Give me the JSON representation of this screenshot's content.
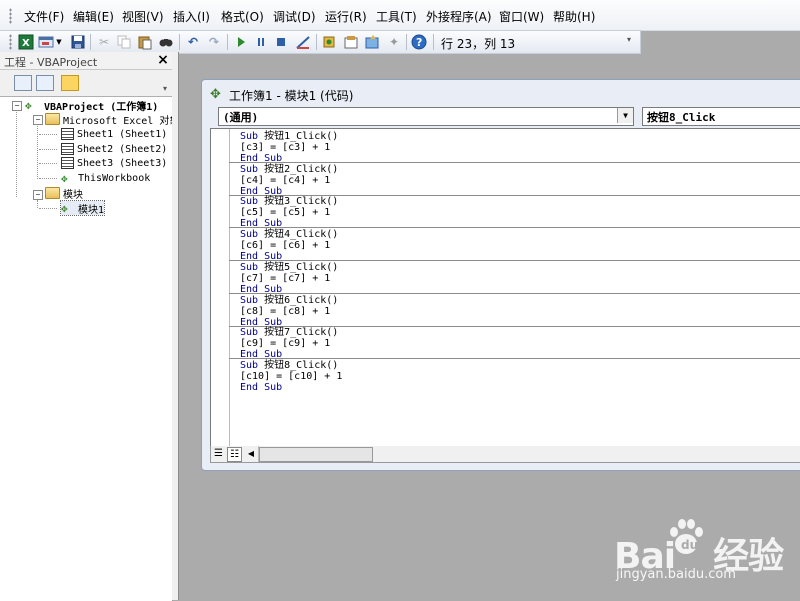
{
  "menubar": {
    "items": [
      "文件(F)",
      "编辑(E)",
      "视图(V)",
      "插入(I)",
      "格式(O)",
      "调试(D)",
      "运行(R)",
      "工具(T)",
      "外接程序(A)",
      "窗口(W)",
      "帮助(H)"
    ]
  },
  "toolbar": {
    "status": "行 23，列 13",
    "icons": [
      "excel-icon",
      "insert-userform-icon",
      "save-icon",
      "cut-icon",
      "copy-icon",
      "paste-icon",
      "find-icon",
      "undo-icon",
      "redo-icon",
      "run-icon",
      "break-icon",
      "reset-icon",
      "design-mode-icon",
      "project-explorer-icon",
      "properties-icon",
      "object-browser-icon",
      "toolbox-icon",
      "help-icon"
    ]
  },
  "project": {
    "title": "工程 - VBAProject",
    "tree": {
      "root": "VBAProject (工作簿1)",
      "excel_objects": "Microsoft Excel 对象",
      "sheets": [
        "Sheet1 (Sheet1)",
        "Sheet2 (Sheet2)",
        "Sheet3 (Sheet3)"
      ],
      "workbook": "ThisWorkbook",
      "modules_folder": "模块",
      "module": "模块1"
    }
  },
  "code_window": {
    "title": "工作簿1 - 模块1 (代码)",
    "object_combo": "(通用)",
    "proc_combo": "按钮8_Click",
    "procedures": [
      {
        "sub": "按钮1_Click()",
        "body": "[c3] = [c3] + 1"
      },
      {
        "sub": "按钮2_Click()",
        "body": "[c4] = [c4] + 1"
      },
      {
        "sub": "按钮3_Click()",
        "body": "[c5] = [c5] + 1"
      },
      {
        "sub": "按钮4_Click()",
        "body": "[c6] = [c6] + 1"
      },
      {
        "sub": "按钮5_Click()",
        "body": "[c7] = [c7] + 1"
      },
      {
        "sub": "按钮6_Click()",
        "body": "[c8] = [c8] + 1"
      },
      {
        "sub": "按钮7_Click()",
        "body": "[c9] = [c9] + 1"
      },
      {
        "sub": "按钮8_Click()",
        "body": "[c10] = [c10] + 1"
      }
    ],
    "kw_sub": "Sub",
    "kw_end_sub": "End Sub"
  },
  "watermark": {
    "logo_left": "Bai",
    "logo_right": "经验",
    "url": "jingyan.baidu.com"
  }
}
